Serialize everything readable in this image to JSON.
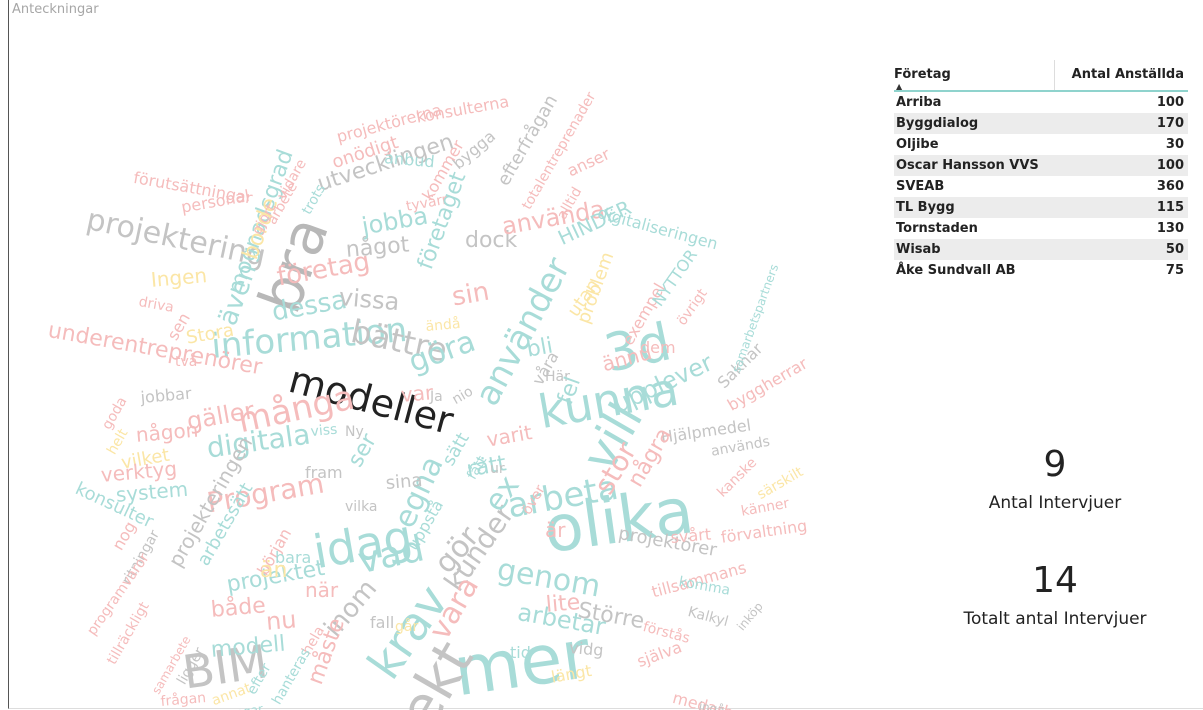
{
  "page": {
    "title": "Anteckningar"
  },
  "wordcloud": {
    "words": [
      {
        "text": "modeller",
        "c": "#222222"
      },
      {
        "text": "olika",
        "c": "#a8dcd8"
      },
      {
        "text": "mer",
        "c": "#a8dcd8"
      },
      {
        "text": "kunna",
        "c": "#a8dcd8"
      },
      {
        "text": "3d",
        "c": "#a8dcd8"
      },
      {
        "text": "idag",
        "c": "#a8dcd8"
      },
      {
        "text": "bra",
        "c": "#b8b8b8"
      },
      {
        "text": "BIM",
        "c": "#c4c4c4"
      },
      {
        "text": "krav",
        "c": "#a8dcd8"
      },
      {
        "text": "vill",
        "c": "#a8dcd8"
      },
      {
        "text": "projektering",
        "c": "#c4c4c4"
      },
      {
        "text": "information",
        "c": "#a8dcd8"
      },
      {
        "text": "bättre",
        "c": "#c4c4c4"
      },
      {
        "text": "många",
        "c": "#f5bcbc"
      },
      {
        "text": "arbeta",
        "c": "#a8dcd8"
      },
      {
        "text": "använder",
        "c": "#a8dcd8"
      },
      {
        "text": "underentreprenörer",
        "c": "#f5bcbc"
      },
      {
        "text": "Program",
        "c": "#f5bcbc"
      },
      {
        "text": "digitala",
        "c": "#a8dcd8"
      },
      {
        "text": "vad",
        "c": "#a8dcd8"
      },
      {
        "text": "genom",
        "c": "#a8dcd8"
      },
      {
        "text": "kunder",
        "c": "#c4c4c4"
      },
      {
        "text": "egna",
        "c": "#a8dcd8"
      },
      {
        "text": "göra",
        "c": "#a8dcd8"
      },
      {
        "text": "dessa",
        "c": "#a8dcd8"
      },
      {
        "text": "företag",
        "c": "#f5bcbc"
      },
      {
        "text": "vissa",
        "c": "#c4c4c4"
      },
      {
        "text": "något",
        "c": "#c4c4c4"
      },
      {
        "text": "dock",
        "c": "#c4c4c4"
      },
      {
        "text": "använda",
        "c": "#f5bcbc"
      },
      {
        "text": "sin",
        "c": "#f5bcbc"
      },
      {
        "text": "jobba",
        "c": "#a8dcd8"
      },
      {
        "text": "utvecklingen",
        "c": "#c4c4c4"
      },
      {
        "text": "onödigt",
        "c": "#f5bcbc"
      },
      {
        "text": "bygga",
        "c": "#c4c4c4"
      },
      {
        "text": "projektörer",
        "c": "#c4c4c4"
      },
      {
        "text": "Större",
        "c": "#c4c4c4"
      },
      {
        "text": "arbetar",
        "c": "#a8dcd8"
      },
      {
        "text": "tillsammans",
        "c": "#f5bcbc"
      },
      {
        "text": "svårt",
        "c": "#f5bcbc"
      },
      {
        "text": "förvaltning",
        "c": "#f5bcbc"
      },
      {
        "text": "Hjälpmedel",
        "c": "#c4c4c4"
      },
      {
        "text": "används",
        "c": "#c4c4c4"
      },
      {
        "text": "upplever",
        "c": "#a8dcd8"
      },
      {
        "text": "ännu",
        "c": "#f5bcbc"
      },
      {
        "text": "byggherrar",
        "c": "#f5bcbc"
      },
      {
        "text": "Saknar",
        "c": "#c4c4c4"
      },
      {
        "text": "samarbetspartners",
        "c": "#a8dcd8"
      },
      {
        "text": "digitaliseringen",
        "c": "#a8dcd8"
      },
      {
        "text": "HINDER",
        "c": "#a8dcd8"
      },
      {
        "text": "anser",
        "c": "#f5bcbc"
      },
      {
        "text": "efterfrågan",
        "c": "#c4c4c4"
      },
      {
        "text": "totalentreprenader",
        "c": "#f5bcbc"
      },
      {
        "text": "konsulterna",
        "c": "#f5bcbc"
      },
      {
        "text": "projektörerna",
        "c": "#f5bcbc"
      },
      {
        "text": "mognadsgrad",
        "c": "#a8dcd8"
      },
      {
        "text": "förutsättningar",
        "c": "#f5bcbc"
      },
      {
        "text": "personal",
        "c": "#f5bcbc"
      },
      {
        "text": "anbud",
        "c": "#a8dcd8"
      },
      {
        "text": "vidare",
        "c": "#f5bcbc"
      },
      {
        "text": "Ingen",
        "c": "#fbe6a6"
      },
      {
        "text": "driva",
        "c": "#f5bcbc"
      },
      {
        "text": "även",
        "c": "#a8dcd8"
      },
      {
        "text": "Stora",
        "c": "#fbe6a6"
      },
      {
        "text": "jobbar",
        "c": "#c4c4c4"
      },
      {
        "text": "gäller",
        "c": "#f5bcbc"
      },
      {
        "text": "någon",
        "c": "#f5bcbc"
      },
      {
        "text": "vilket",
        "c": "#fbe6a6"
      },
      {
        "text": "verktyg",
        "c": "#f5bcbc"
      },
      {
        "text": "system",
        "c": "#a8dcd8"
      },
      {
        "text": "konsulter",
        "c": "#a8dcd8"
      },
      {
        "text": "fram",
        "c": "#c4c4c4"
      },
      {
        "text": "sina",
        "c": "#c4c4c4"
      },
      {
        "text": "vilka",
        "c": "#c4c4c4"
      },
      {
        "text": "ritningar",
        "c": "#c4c4c4"
      },
      {
        "text": "programvaror",
        "c": "#f5bcbc"
      },
      {
        "text": "tillräckligt",
        "c": "#f5bcbc"
      },
      {
        "text": "samarbete",
        "c": "#f5bcbc"
      },
      {
        "text": "projektet",
        "c": "#a8dcd8"
      },
      {
        "text": "både",
        "c": "#f5bcbc"
      },
      {
        "text": "nu",
        "c": "#f5bcbc"
      },
      {
        "text": "modell",
        "c": "#a8dcd8"
      },
      {
        "text": "ligger",
        "c": "#c4c4c4"
      },
      {
        "text": "frågan",
        "c": "#f5bcbc"
      },
      {
        "text": "fall",
        "c": "#c4c4c4"
      },
      {
        "text": "går",
        "c": "#fbe6a6"
      },
      {
        "text": "tid",
        "c": "#a8dcd8"
      },
      {
        "text": "längt",
        "c": "#fbe6a6"
      },
      {
        "text": "vidg",
        "c": "#c4c4c4"
      },
      {
        "text": "själva",
        "c": "#f5bcbc"
      },
      {
        "text": "förstås",
        "c": "#f5bcbc"
      },
      {
        "text": "Kalkyl",
        "c": "#c4c4c4"
      },
      {
        "text": "inköp",
        "c": "#c4c4c4"
      },
      {
        "text": "komma",
        "c": "#a8dcd8"
      },
      {
        "text": "kanske",
        "c": "#f5bcbc"
      },
      {
        "text": "känner",
        "c": "#f5bcbc"
      },
      {
        "text": "särskilt",
        "c": "#fbe6a6"
      },
      {
        "text": "medarbetare",
        "c": "#f5bcbc"
      },
      {
        "text": "ex",
        "c": "#a8dcd8"
      },
      {
        "text": "varit",
        "c": "#f5bcbc"
      },
      {
        "text": "rätt",
        "c": "#a8dcd8"
      },
      {
        "text": "ur",
        "c": "#c4c4c4"
      },
      {
        "text": "över",
        "c": "#f5bcbc"
      },
      {
        "text": "är",
        "c": "#f5bcbc"
      },
      {
        "text": "stor",
        "c": "#f5bcbc"
      },
      {
        "text": "några",
        "c": "#f5bcbc"
      },
      {
        "text": "lite",
        "c": "#f5bcbc"
      },
      {
        "text": "ser",
        "c": "#a8dcd8"
      },
      {
        "text": "viss",
        "c": "#a8dcd8"
      },
      {
        "text": "Ny",
        "c": "#c4c4c4"
      },
      {
        "text": "nog",
        "c": "#f5bcbc"
      },
      {
        "text": "början",
        "c": "#f5bcbc"
      },
      {
        "text": "bara",
        "c": "#a8dcd8"
      },
      {
        "text": "än",
        "c": "#fbe6a6"
      },
      {
        "text": "när",
        "c": "#f5bcbc"
      },
      {
        "text": "inom",
        "c": "#c4c4c4"
      },
      {
        "text": "måste",
        "c": "#f5bcbc"
      },
      {
        "text": "hela",
        "c": "#f5bcbc"
      },
      {
        "text": "gör",
        "c": "#c4c4c4"
      },
      {
        "text": "vara",
        "c": "#f5bcbc"
      },
      {
        "text": "uppstå",
        "c": "#a8dcd8"
      },
      {
        "text": "sätt",
        "c": "#a8dcd8"
      },
      {
        "text": "fått",
        "c": "#a8dcd8"
      },
      {
        "text": "var",
        "c": "#f5bcbc"
      },
      {
        "text": "Ja",
        "c": "#c4c4c4"
      },
      {
        "text": "nio",
        "c": "#c4c4c4"
      },
      {
        "text": "våra",
        "c": "#c4c4c4"
      },
      {
        "text": "Här",
        "c": "#c4c4c4"
      },
      {
        "text": "bli",
        "c": "#a8dcd8"
      },
      {
        "text": "utan",
        "c": "#fbe6a6"
      },
      {
        "text": "fel",
        "c": "#a8dcd8"
      },
      {
        "text": "problem",
        "c": "#fbe6a6"
      },
      {
        "text": "dem",
        "c": "#f5bcbc"
      },
      {
        "text": "exempel",
        "c": "#f5bcbc"
      },
      {
        "text": "NYTTOR",
        "c": "#a8dcd8"
      },
      {
        "text": "övrigt",
        "c": "#f5bcbc"
      },
      {
        "text": "ändå",
        "c": "#fbe6a6"
      },
      {
        "text": "tyvärr",
        "c": "#f5bcbc"
      },
      {
        "text": "kommer",
        "c": "#f5bcbc"
      },
      {
        "text": "alltid",
        "c": "#f5bcbc"
      },
      {
        "text": "borde",
        "c": "#fbe6a6"
      },
      {
        "text": "gjort",
        "c": "#f5bcbc"
      },
      {
        "text": "arbete",
        "c": "#f5bcbc"
      },
      {
        "text": "trots",
        "c": "#a8dcd8"
      },
      {
        "text": "sen",
        "c": "#f5bcbc"
      },
      {
        "text": "två",
        "c": "#f5bcbc"
      },
      {
        "text": "goda",
        "c": "#f5bcbc"
      },
      {
        "text": "helt",
        "c": "#fbe6a6"
      },
      {
        "text": "arbetssätt",
        "c": "#a8dcd8"
      },
      {
        "text": "projekteringen",
        "c": "#c4c4c4"
      },
      {
        "text": "ingå",
        "c": "#c4c4c4"
      },
      {
        "text": "annat",
        "c": "#fbe6a6"
      },
      {
        "text": "efter",
        "c": "#a8dcd8"
      },
      {
        "text": "hanteras",
        "c": "#a8dcd8"
      },
      {
        "text": "pengar",
        "c": "#a8dcd8"
      },
      {
        "text": "pro",
        "c": "#c4c4c4"
      },
      {
        "text": "företaget",
        "c": "#a8dcd8"
      },
      {
        "text": "ekt",
        "c": "#c4c4c4"
      }
    ]
  },
  "table": {
    "headers": {
      "company": "Företag",
      "employees": "Antal Anställda"
    },
    "rows": [
      {
        "company": "Arriba",
        "employees": "100"
      },
      {
        "company": "Byggdialog",
        "employees": "170"
      },
      {
        "company": "Oljibe",
        "employees": "30"
      },
      {
        "company": "Oscar Hansson VVS",
        "employees": "100"
      },
      {
        "company": "SVEAB",
        "employees": "360"
      },
      {
        "company": "TL Bygg",
        "employees": "115"
      },
      {
        "company": "Tornstaden",
        "employees": "130"
      },
      {
        "company": "Wisab",
        "employees": "50"
      },
      {
        "company": "Åke Sundvall AB",
        "employees": "75"
      }
    ]
  },
  "cards": {
    "interviews": {
      "value": "9",
      "label": "Antal Intervjuer"
    },
    "total_interviews": {
      "value": "14",
      "label": "Totalt antal Intervjuer"
    }
  }
}
